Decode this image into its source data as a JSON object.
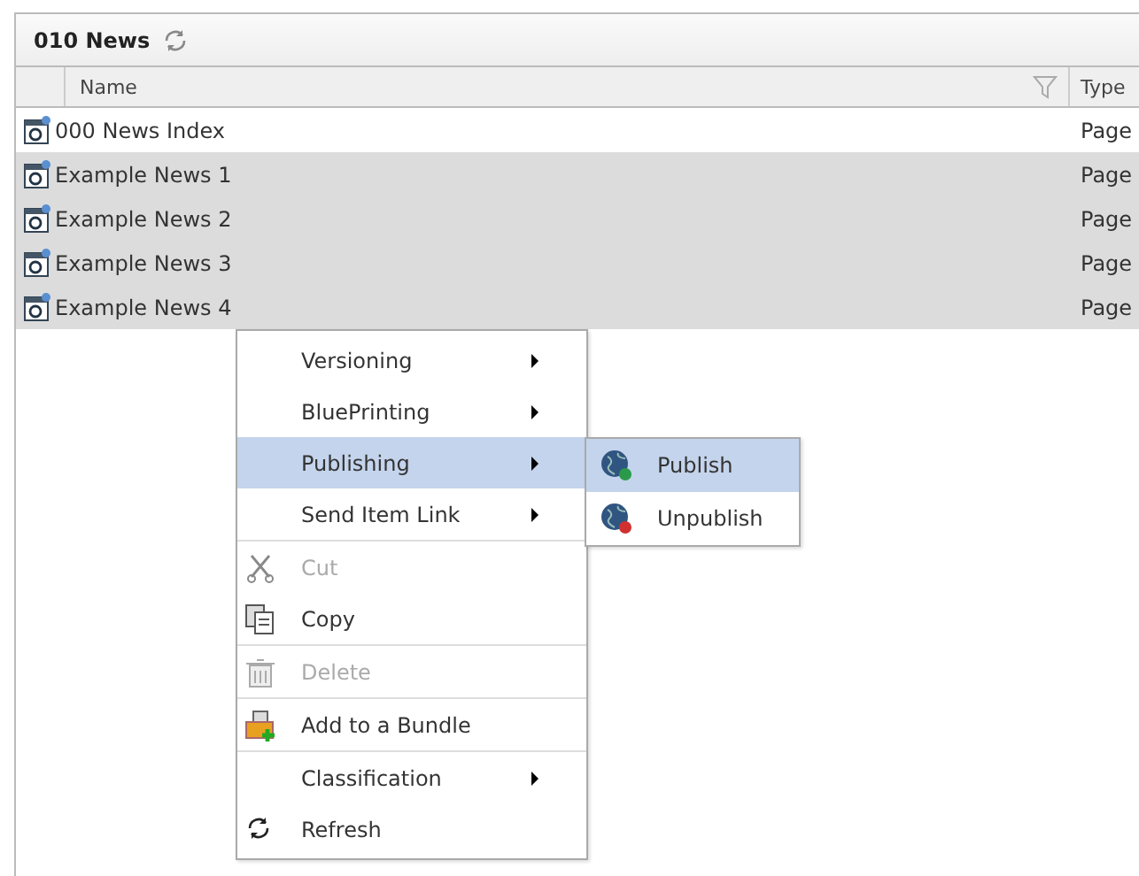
{
  "panel": {
    "title": "010 News"
  },
  "table": {
    "columns": [
      "Name",
      "Type"
    ],
    "rows": [
      {
        "name": "000 News Index",
        "type": "Page",
        "selected": false
      },
      {
        "name": "Example News 1",
        "type": "Page",
        "selected": true
      },
      {
        "name": "Example News 2",
        "type": "Page",
        "selected": true
      },
      {
        "name": "Example News 3",
        "type": "Page",
        "selected": true
      },
      {
        "name": "Example News 4",
        "type": "Page",
        "selected": true
      }
    ]
  },
  "context_menu": {
    "items": [
      {
        "kind": "submenu",
        "label": "Versioning",
        "selected": false,
        "disabled": false
      },
      {
        "kind": "submenu",
        "label": "BluePrinting",
        "selected": false,
        "disabled": false
      },
      {
        "kind": "submenu",
        "label": "Publishing",
        "selected": true,
        "disabled": false
      },
      {
        "kind": "submenu",
        "label": "Send Item Link",
        "selected": false,
        "disabled": false
      },
      {
        "kind": "separator"
      },
      {
        "kind": "command",
        "label": "Cut",
        "selected": false,
        "disabled": true
      },
      {
        "kind": "command",
        "label": "Copy",
        "selected": false,
        "disabled": false
      },
      {
        "kind": "separator"
      },
      {
        "kind": "command",
        "label": "Delete",
        "selected": false,
        "disabled": true
      },
      {
        "kind": "separator"
      },
      {
        "kind": "command",
        "label": "Add to a Bundle",
        "selected": false,
        "disabled": false
      },
      {
        "kind": "separator"
      },
      {
        "kind": "submenu",
        "label": "Classification",
        "selected": false,
        "disabled": false
      },
      {
        "kind": "command",
        "label": "Refresh",
        "selected": false,
        "disabled": false
      }
    ]
  },
  "submenu": {
    "items": [
      {
        "label": "Publish",
        "selected": true
      },
      {
        "label": "Unpublish",
        "selected": false
      }
    ]
  }
}
